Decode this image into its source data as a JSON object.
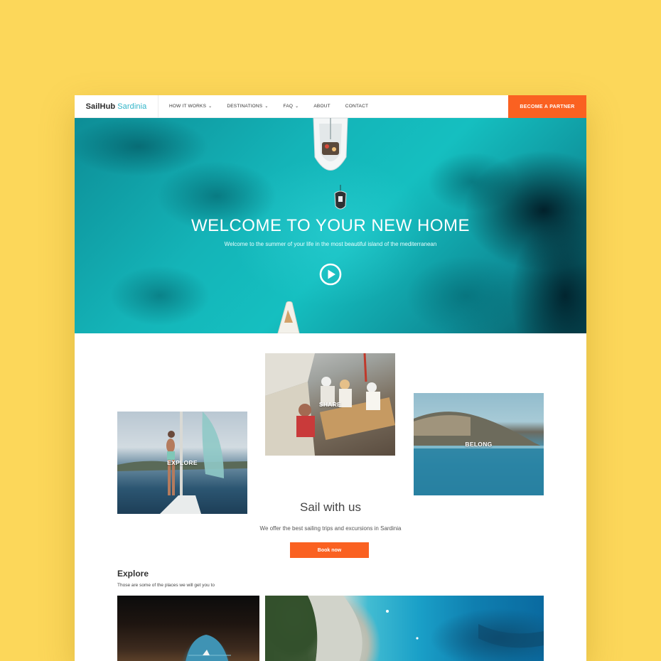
{
  "nav": {
    "logo_main": "SailHub",
    "logo_accent": "Sardinia",
    "items": [
      {
        "label": "HOW IT WORKS",
        "has_dropdown": true
      },
      {
        "label": "DESTINATIONS",
        "has_dropdown": true
      },
      {
        "label": "FAQ",
        "has_dropdown": true
      },
      {
        "label": "ABOUT",
        "has_dropdown": false
      },
      {
        "label": "CONTACT",
        "has_dropdown": false
      }
    ],
    "cta_label": "BECOME A PARTNER"
  },
  "hero": {
    "title": "WELCOME TO YOUR NEW HOME",
    "subtitle": "Welcome to the summer of your life in the most beautiful island of the mediterranean",
    "play_icon": "play-circle-icon"
  },
  "gallery": {
    "explore_label": "EXPLORE",
    "share_label": "SHARE",
    "belong_label": "BELONG"
  },
  "sail": {
    "title": "Sail with us",
    "subtitle": "We offer the best sailing trips and excursions in Sardinia",
    "book_label": "Book now"
  },
  "explore": {
    "title": "Explore",
    "subtitle": "Those are some of the places we will get you to"
  },
  "colors": {
    "background": "#fcd75a",
    "accent_orange": "#fa6121",
    "logo_teal": "#2fb4c8",
    "sea": "#14b4b8"
  }
}
